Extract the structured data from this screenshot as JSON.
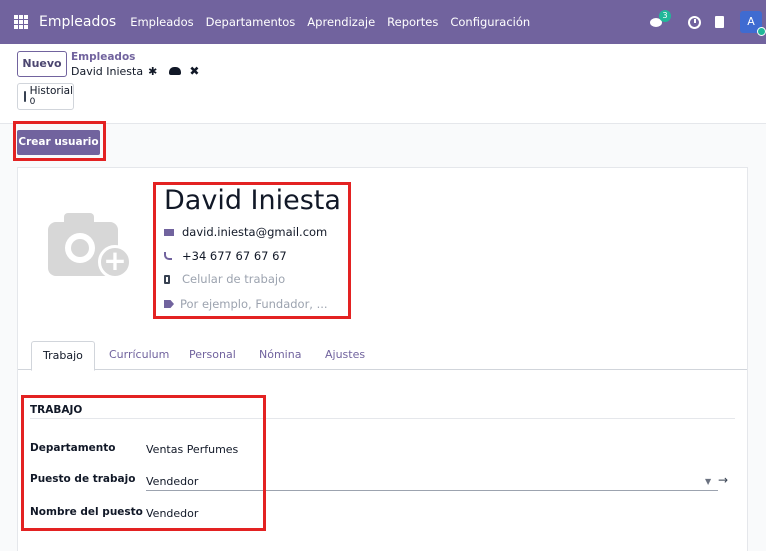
{
  "navbar": {
    "brand": "Empleados",
    "menu": [
      "Empleados",
      "Departamentos",
      "Aprendizaje",
      "Reportes",
      "Configuración"
    ],
    "chat_badge": "3",
    "avatar_initial": "A"
  },
  "control": {
    "new_label": "Nuevo",
    "breadcrumb": "Empleados",
    "record_name": "David Iniesta",
    "history_label": "Historial",
    "history_count": "0"
  },
  "statusbar": {
    "create_user_label": "Crear usuario"
  },
  "employee": {
    "name": "David Iniesta",
    "email": "david.iniesta@gmail.com",
    "phone": "+34 677 67 67 67",
    "mobile_placeholder": "Celular de trabajo",
    "job_title_placeholder": "Por ejemplo, Fundador, ..."
  },
  "tabs": [
    "Trabajo",
    "Currículum",
    "Personal",
    "Nómina",
    "Ajustes"
  ],
  "work": {
    "section_title": "TRABAJO",
    "department_label": "Departamento",
    "department_value": "Ventas Perfumes",
    "position_label": "Puesto de trabajo",
    "position_value": "Vendedor",
    "job_name_label": "Nombre del puesto",
    "job_name_value": "Vendedor"
  },
  "colors": {
    "primary": "#71639e",
    "highlight": "#e32222",
    "status_green": "#21b799"
  }
}
